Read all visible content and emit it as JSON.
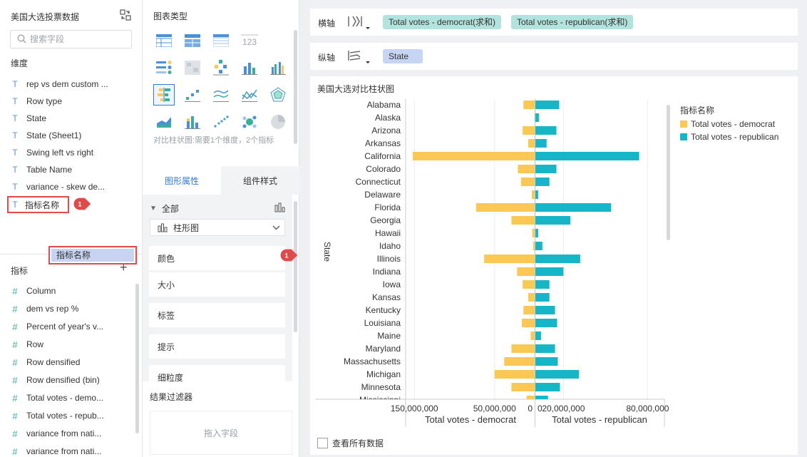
{
  "left_panel": {
    "title": "美国大选投票数据",
    "search_placeholder": "搜索字段",
    "dimensions_label": "维度",
    "dimensions": [
      "rep vs dem custom ...",
      "Row type",
      "State",
      "State (Sheet1)",
      "Swing left vs right",
      "Table Name",
      "variance - skew de...",
      "指标名称"
    ],
    "measures_label": "指标",
    "measures": [
      "Column",
      "dem vs rep %",
      "Percent of year's v...",
      "Row",
      "Row densified",
      "Row densified (bin)",
      "Total votes - demo...",
      "Total votes - repub...",
      "variance from nati...",
      "variance from nati..."
    ]
  },
  "callouts": {
    "badge_1": "1",
    "badge_2": "1"
  },
  "middle_panel": {
    "chart_types_label": "图表类型",
    "chart_type_desc": "对比柱状图:需要1个维度，2个指标",
    "tab_graph_props": "图形属性",
    "tab_component_style": "组件样式",
    "all_label": "全部",
    "mark_type": "柱形图",
    "color_label": "颜色",
    "color_field": "指标名称",
    "size_label": "大小",
    "label_label": "标签",
    "tooltip_label": "提示",
    "granularity_label": "细粒度",
    "filter_label": "结果过滤器",
    "drop_placeholder": "拖入字段"
  },
  "x_axis_row": {
    "label": "横轴",
    "pills": [
      "Total votes - democrat(求和)",
      "Total votes - republican(求和)"
    ]
  },
  "y_axis_row": {
    "label": "纵轴",
    "pills": [
      "State"
    ]
  },
  "chart_card": {
    "title": "美国大选对比柱状图",
    "show_all_data": "查看所有数据"
  },
  "colors": {
    "democrat": "#fcc855",
    "republican": "#16b6c8",
    "accent": "#2e7bd6",
    "callout": "#e04a4a"
  },
  "chart_data": {
    "type": "bar",
    "orientation": "horizontal-diverging",
    "ylabel": "State",
    "legend_title": "指标名称",
    "legend_position": "right",
    "categories": [
      "Alabama",
      "Alaska",
      "Arizona",
      "Arkansas",
      "California",
      "Colorado",
      "Connecticut",
      "Delaware",
      "Florida",
      "Georgia",
      "Hawaii",
      "Idaho",
      "Illinois",
      "Indiana",
      "Iowa",
      "Kansas",
      "Kentucky",
      "Louisiana",
      "Maine",
      "Maryland",
      "Massachusetts",
      "Michigan",
      "Minnesota",
      "Mississippi"
    ],
    "series": [
      {
        "name": "Total votes - democrat",
        "axis_label": "Total votes - democrat",
        "xlim": [
          0,
          160000000
        ],
        "ticks": [
          "150,000,000",
          "50,000,000",
          "0"
        ],
        "tick_values": [
          150000000,
          50000000,
          0
        ],
        "values": [
          14000000,
          500000,
          15000000,
          8000000,
          152000000,
          21000000,
          17000000,
          3500000,
          73000000,
          29000000,
          3000000,
          2000000,
          63000000,
          22000000,
          15000000,
          8000000,
          14000000,
          16000000,
          5000000,
          29000000,
          38000000,
          50000000,
          29000000,
          10000000
        ]
      },
      {
        "name": "Total votes - republican",
        "axis_label": "Total votes - republican",
        "xlim": [
          0,
          92000000
        ],
        "ticks": [
          "0",
          "20,000,000",
          "80,000,000"
        ],
        "tick_values": [
          0,
          20000000,
          80000000
        ],
        "values": [
          17000000,
          2500000,
          15000000,
          8000000,
          74000000,
          15000000,
          10000000,
          2000000,
          54000000,
          25000000,
          2000000,
          5000000,
          32000000,
          20000000,
          10000000,
          10000000,
          14000000,
          15500000,
          4000000,
          14000000,
          16000000,
          31000000,
          17500000,
          9000000
        ]
      }
    ]
  }
}
